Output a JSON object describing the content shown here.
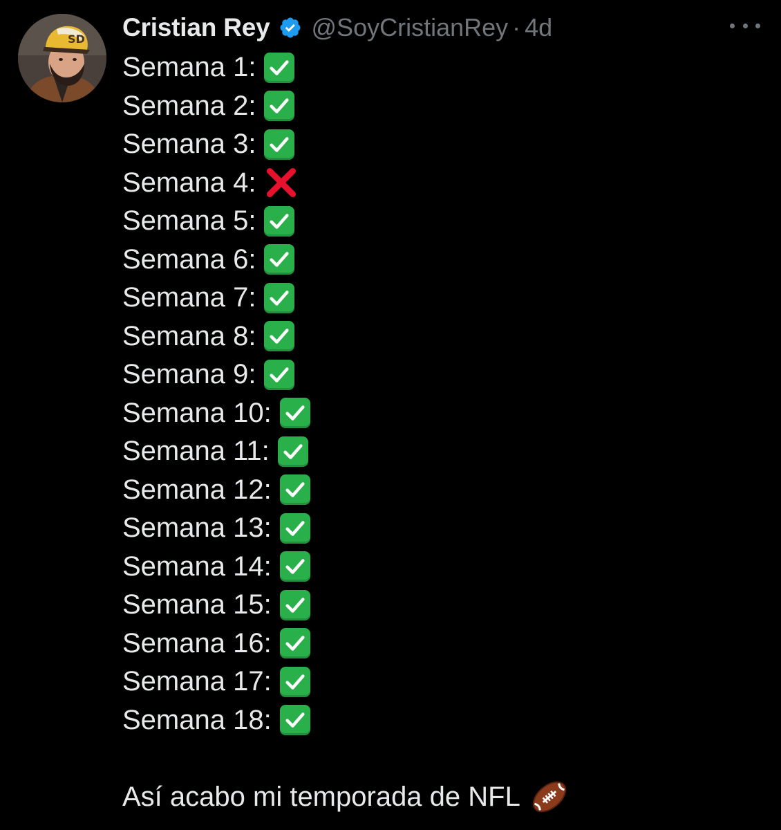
{
  "author": {
    "name": "Cristian Rey",
    "handle": "@SoyCristianRey",
    "separator": "·",
    "time": "4d",
    "verified": true,
    "avatar_icon": "profile-photo-man-with-cap"
  },
  "menu": {
    "icon": "more-options-icon"
  },
  "weeks": [
    {
      "label": "Semana 1:",
      "status": "check"
    },
    {
      "label": "Semana 2:",
      "status": "check"
    },
    {
      "label": "Semana 3:",
      "status": "check"
    },
    {
      "label": "Semana 4:",
      "status": "cross"
    },
    {
      "label": "Semana 5:",
      "status": "check"
    },
    {
      "label": "Semana 6:",
      "status": "check"
    },
    {
      "label": "Semana 7:",
      "status": "check"
    },
    {
      "label": "Semana 8:",
      "status": "check"
    },
    {
      "label": "Semana 9:",
      "status": "check"
    },
    {
      "label": "Semana 10:",
      "status": "check"
    },
    {
      "label": "Semana 11:",
      "status": "check"
    },
    {
      "label": "Semana 12:",
      "status": "check"
    },
    {
      "label": "Semana 13:",
      "status": "check"
    },
    {
      "label": "Semana 14:",
      "status": "check"
    },
    {
      "label": "Semana 15:",
      "status": "check"
    },
    {
      "label": "Semana 16:",
      "status": "check"
    },
    {
      "label": "Semana 17:",
      "status": "check"
    },
    {
      "label": "Semana 18:",
      "status": "check"
    }
  ],
  "closing_text": "Así acabo mi temporada de NFL",
  "closing_icon": "american-football-icon",
  "colors": {
    "background": "#000000",
    "text": "#e7e9ea",
    "muted": "#71767b",
    "verified_blue": "#1d9bf0",
    "check_green": "#2ab04a",
    "cross_red": "#e8112d"
  }
}
